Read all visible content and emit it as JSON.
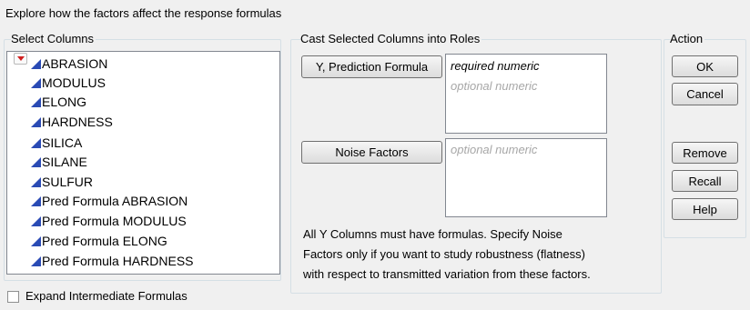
{
  "instruction": "Explore how the factors affect the response formulas",
  "select_columns": {
    "title": "Select Columns",
    "items": [
      "ABRASION",
      "MODULUS",
      "ELONG",
      "HARDNESS",
      "SILICA",
      "SILANE",
      "SULFUR",
      "Pred Formula ABRASION",
      "Pred Formula MODULUS",
      "Pred Formula ELONG",
      "Pred Formula HARDNESS"
    ]
  },
  "cast": {
    "title": "Cast Selected Columns into Roles",
    "y_button": "Y, Prediction Formula",
    "y_required": "required numeric",
    "y_optional": "optional numeric",
    "noise_button": "Noise Factors",
    "noise_optional": "optional numeric",
    "note_lines": [
      "All Y Columns must have formulas.  Specify Noise",
      "Factors only if you want to study robustness (flatness)",
      "with respect to transmitted variation from these factors."
    ]
  },
  "action": {
    "title": "Action",
    "ok": "OK",
    "cancel": "Cancel",
    "remove": "Remove",
    "recall": "Recall",
    "help": "Help"
  },
  "expand_checkbox": {
    "label": "Expand Intermediate Formulas",
    "checked": false
  },
  "colors": {
    "column_icon": "#2a4bb5",
    "menu_arrow": "#d02020",
    "optional_text": "#a7a7a7"
  }
}
